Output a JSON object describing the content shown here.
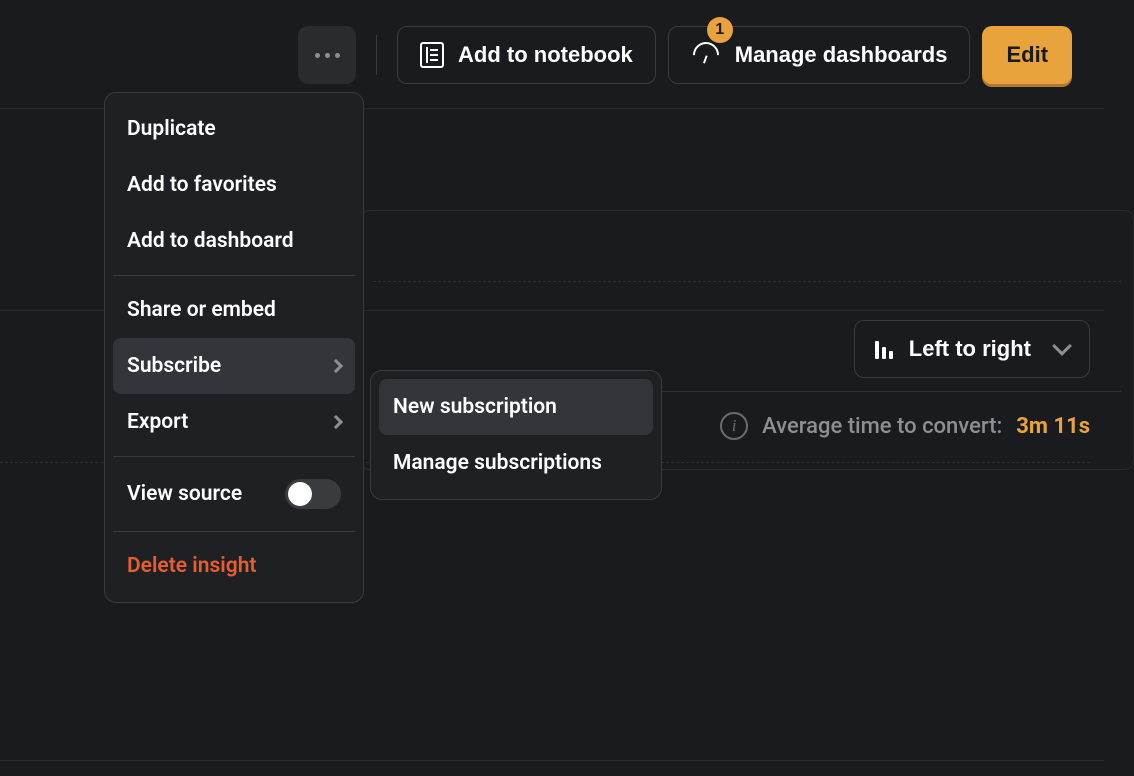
{
  "toolbar": {
    "add_to_notebook": "Add to notebook",
    "manage_dashboards": "Manage dashboards",
    "dashboards_badge": "1",
    "edit": "Edit"
  },
  "layout": {
    "selected": "Left to right"
  },
  "stats": {
    "avg_time_label": "Average time to convert:",
    "avg_time_value": "3m 11s"
  },
  "menu": {
    "duplicate": "Duplicate",
    "add_to_favorites": "Add to favorites",
    "add_to_dashboard": "Add to dashboard",
    "share_or_embed": "Share or embed",
    "subscribe": "Subscribe",
    "export": "Export",
    "view_source": "View source",
    "delete_insight": "Delete insight"
  },
  "submenu": {
    "new_subscription": "New subscription",
    "manage_subscriptions": "Manage subscriptions"
  }
}
